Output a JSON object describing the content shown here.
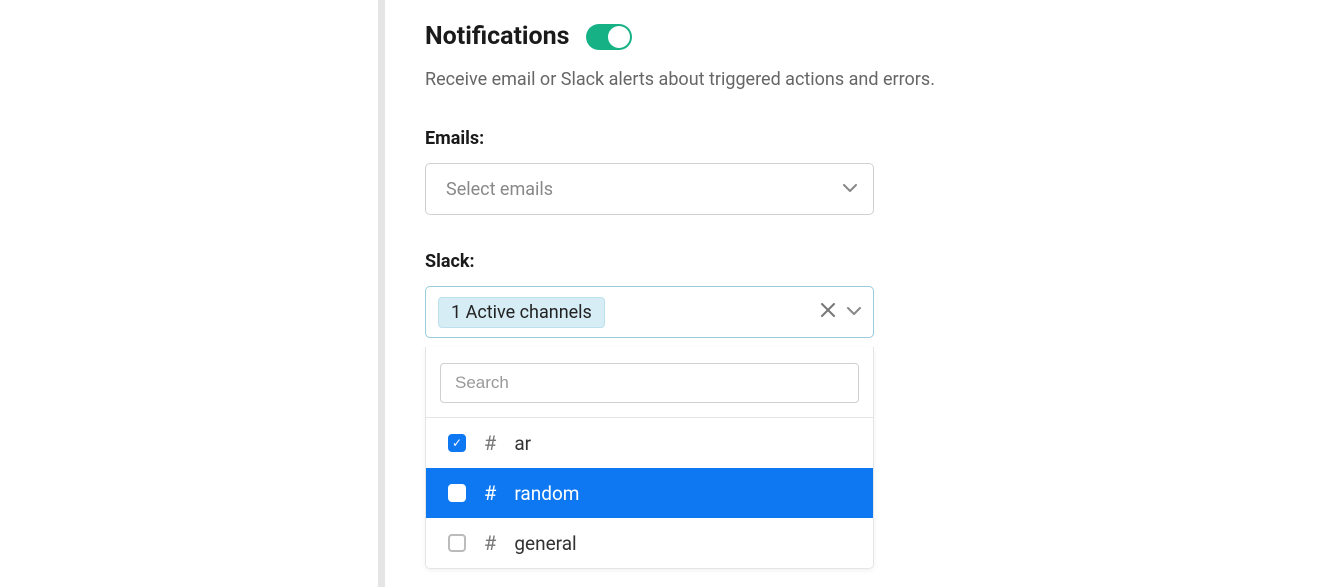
{
  "notifications": {
    "title": "Notifications",
    "toggle_on": true,
    "description": "Receive email or Slack alerts about triggered actions and errors.",
    "emails": {
      "label": "Emails:",
      "placeholder": "Select emails"
    },
    "slack": {
      "label": "Slack:",
      "chip": "1 Active channels",
      "search_placeholder": "Search",
      "options": [
        {
          "name": "ar",
          "checked": true,
          "highlighted": false
        },
        {
          "name": "random",
          "checked": false,
          "highlighted": true
        },
        {
          "name": "general",
          "checked": false,
          "highlighted": false
        }
      ]
    }
  }
}
